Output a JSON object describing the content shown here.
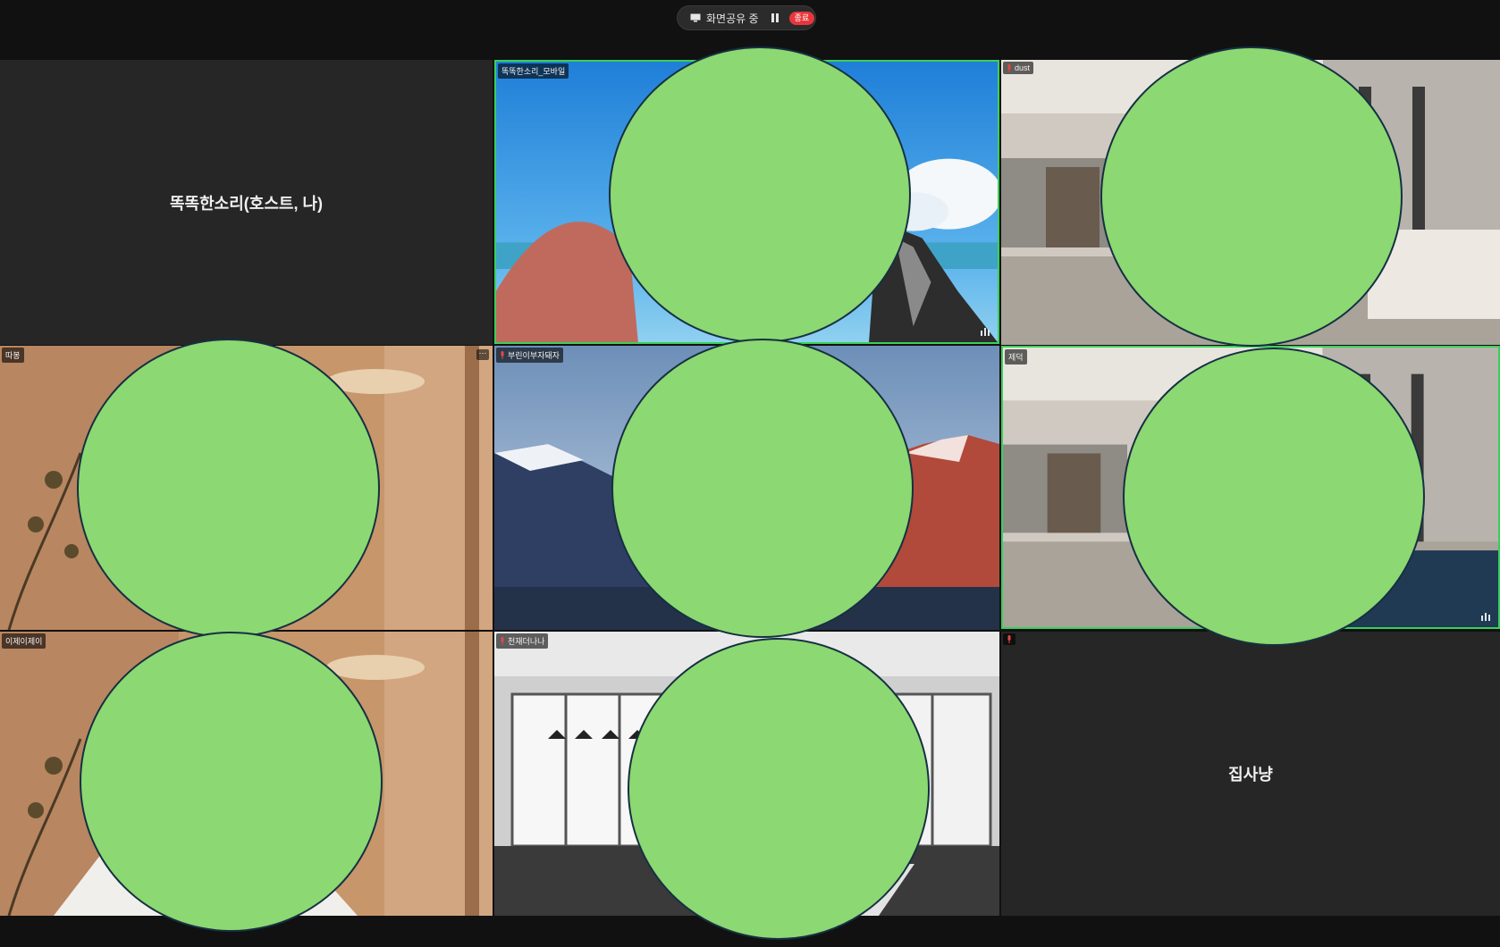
{
  "share_bar": {
    "status_label": "화면공유 중",
    "stop_label": "종료"
  },
  "participants": [
    {
      "name": "똑똑한소리(호스트, 나)",
      "video": false
    },
    {
      "name": "똑똑한소리_모바일",
      "video": true,
      "background": "beach"
    },
    {
      "name": "dust",
      "video": true,
      "background": "lobby"
    },
    {
      "name": "따봉",
      "video": true,
      "background": "warm-room"
    },
    {
      "name": "부린이부자돼자",
      "video": true,
      "background": "mountains"
    },
    {
      "name": "제덕",
      "video": true,
      "background": "lobby"
    },
    {
      "name": "이제이제이",
      "video": true,
      "background": "warm-room"
    },
    {
      "name": "천재더나나",
      "video": true,
      "background": "office"
    },
    {
      "name": "집사냥",
      "video": false
    }
  ],
  "colors": {
    "background": "#111111",
    "tile": "#262626",
    "active_border": "#3ad05a",
    "face_mask": "#8cd872",
    "stop_button": "#e8363c"
  }
}
